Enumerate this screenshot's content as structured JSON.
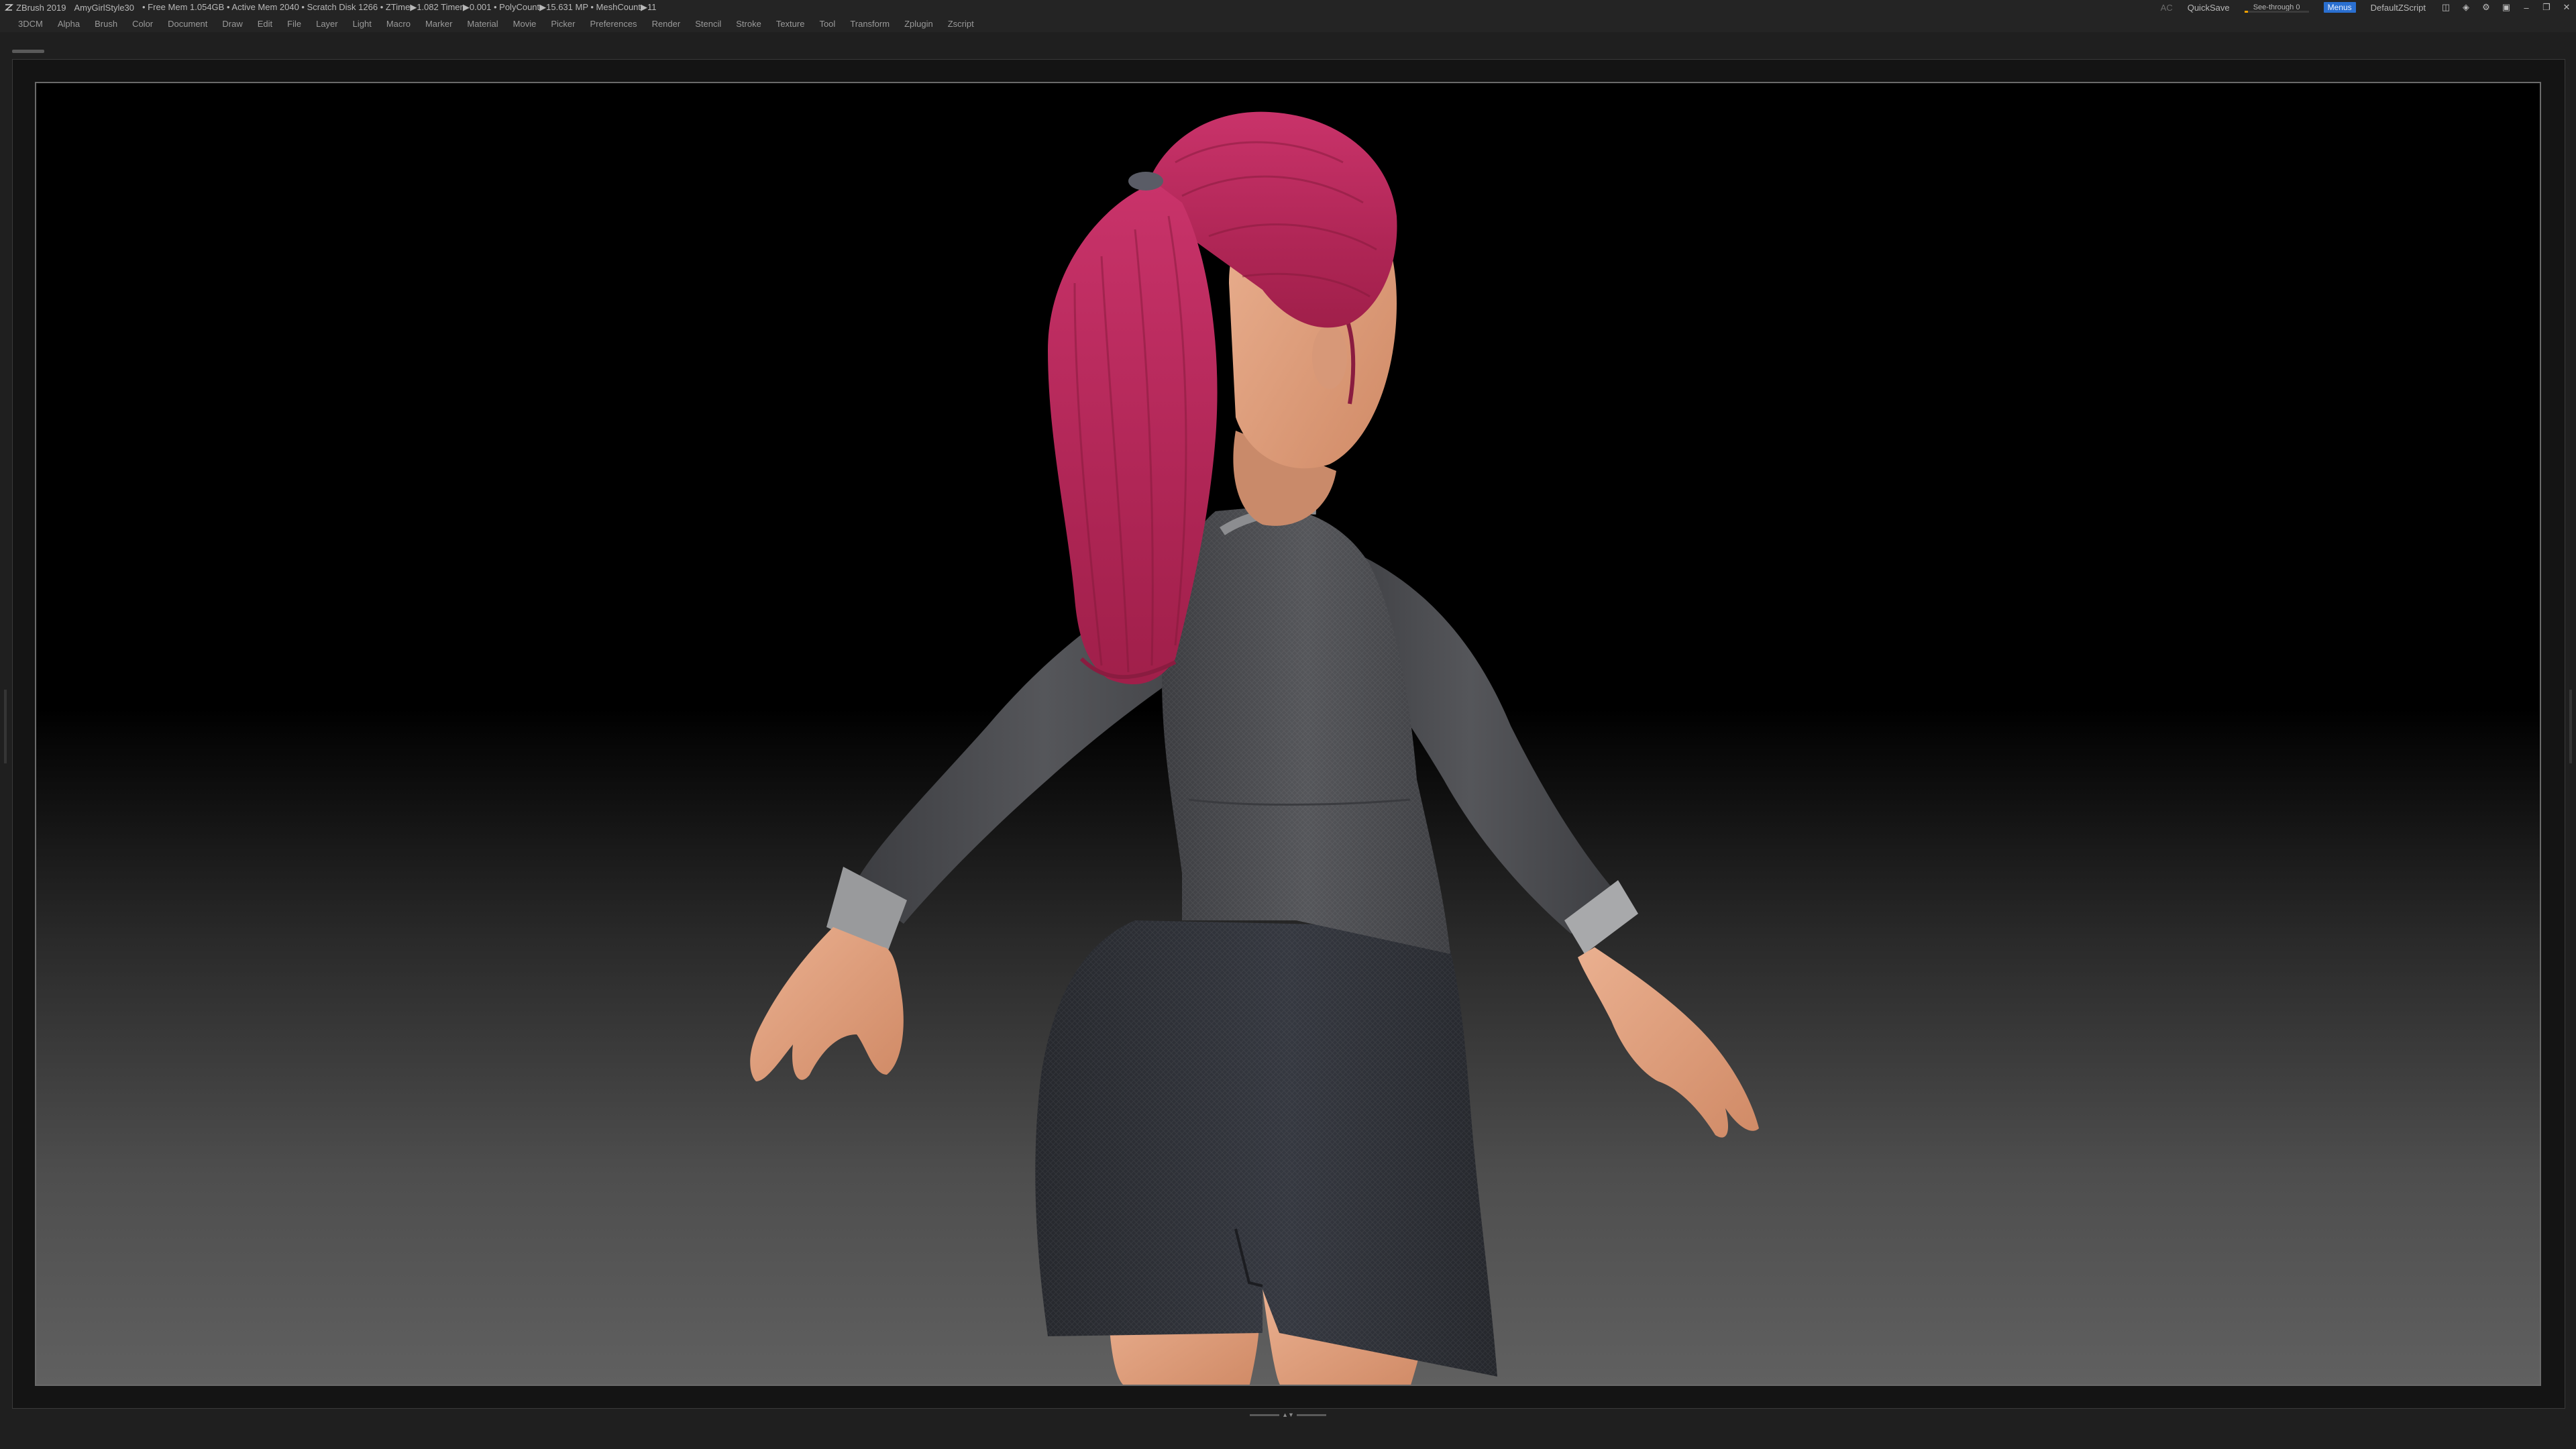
{
  "titlebar": {
    "app_name": "ZBrush 2019",
    "project": "AmyGirlStyle30",
    "stats": "• Free Mem 1.054GB • Active Mem 2040 • Scratch Disk 1266 • ZTime▶1.082 Timer▶0.001 • PolyCount▶15.631 MP • MeshCount▶11",
    "ac_label": "AC",
    "quicksave_label": "QuickSave",
    "seethrough_label": "See-through",
    "seethrough_value": "0",
    "seethrough_fraction": 0.0,
    "menus_label": "Menus",
    "script_label": "DefaultZScript"
  },
  "menubar": {
    "items": [
      "3DCM",
      "Alpha",
      "Brush",
      "Color",
      "Document",
      "Draw",
      "Edit",
      "File",
      "Layer",
      "Light",
      "Macro",
      "Marker",
      "Material",
      "Movie",
      "Picker",
      "Preferences",
      "Render",
      "Stencil",
      "Stroke",
      "Texture",
      "Tool",
      "Transform",
      "Zplugin",
      "Zscript"
    ]
  },
  "icons": {
    "app": "zbrush-logo-icon",
    "window_controls": [
      "layout-icon",
      "palette-icon",
      "settings-icon",
      "lock-icon",
      "minimize-icon",
      "restore-icon",
      "close-icon"
    ]
  },
  "viewport": {
    "subject": "3D sculpt of a cartoon girl with a pink ponytail, grey sweater and dark skirt, viewed from behind",
    "colors": {
      "hair": "#b8285a",
      "hair_highlight": "#d24a7a",
      "skin": "#e2a07c",
      "sweater": "#4a4b4f",
      "cuff": "#9a9a9a",
      "skirt": "#2c2e34",
      "background_top": "#000000",
      "background_bottom": "#606060"
    }
  }
}
